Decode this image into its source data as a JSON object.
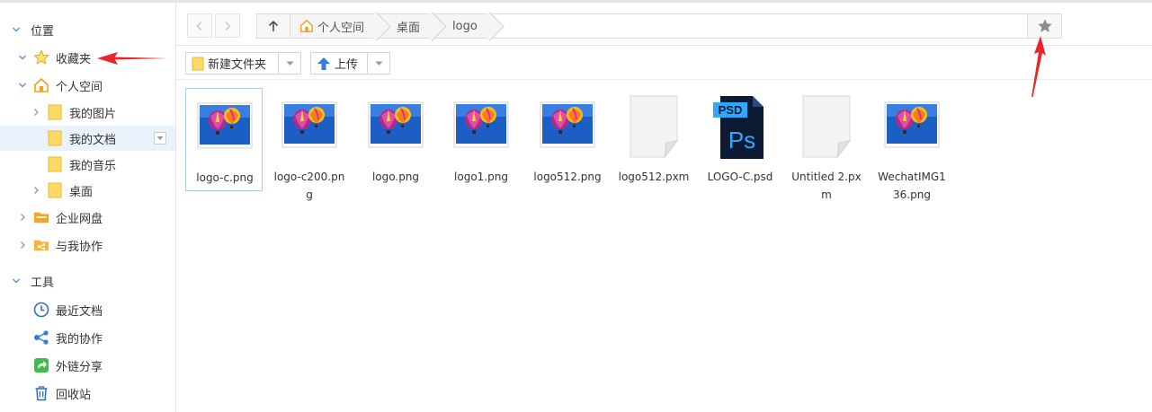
{
  "sidebar": {
    "location_header": "位置",
    "favorites": "收藏夹",
    "personal_space": "个人空间",
    "personal_children": [
      "我的图片",
      "我的文档",
      "我的音乐",
      "桌面"
    ],
    "enterprise_disk": "企业网盘",
    "shared_with_me": "与我协作",
    "tools_header": "工具",
    "tools": [
      "最近文档",
      "我的协作",
      "外链分享",
      "回收站"
    ]
  },
  "breadcrumb": [
    "个人空间",
    "桌面",
    "logo"
  ],
  "toolbar": {
    "new_folder": "新建文件夹",
    "upload": "上传"
  },
  "files": [
    {
      "name": "logo-c.png",
      "type": "image"
    },
    {
      "name": "logo-c200.png",
      "type": "image"
    },
    {
      "name": "logo.png",
      "type": "image"
    },
    {
      "name": "logo1.png",
      "type": "image"
    },
    {
      "name": "logo512.png",
      "type": "image"
    },
    {
      "name": "logo512.pxm",
      "type": "blank"
    },
    {
      "name": "LOGO-C.psd",
      "type": "psd"
    },
    {
      "name": "Untitled 2.pxm",
      "type": "blank"
    },
    {
      "name": "WechatIMG136.png",
      "type": "image"
    }
  ],
  "psd_badge": "PSD",
  "psd_letters": "Ps",
  "colors": {
    "accent": "#2f7fd6",
    "annotation": "#e8262a",
    "folder": "#ffd966",
    "selection": "#eaf2fb"
  }
}
